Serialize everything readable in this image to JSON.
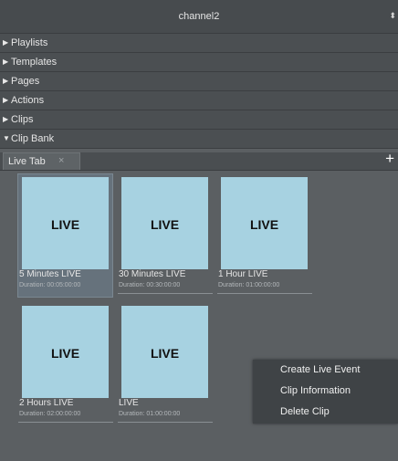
{
  "window": {
    "title": "channel2",
    "updown_icon": "updown-arrows-icon"
  },
  "sections": [
    {
      "label": "Playlists",
      "expanded": false
    },
    {
      "label": "Templates",
      "expanded": false
    },
    {
      "label": "Pages",
      "expanded": false
    },
    {
      "label": "Actions",
      "expanded": false
    },
    {
      "label": "Clips",
      "expanded": false
    },
    {
      "label": "Clip Bank",
      "expanded": true
    }
  ],
  "arrows": {
    "collapsed": "▶",
    "expanded": "▼"
  },
  "tabs": [
    {
      "label": "Live Tab",
      "close": "×"
    }
  ],
  "add_tab": "+",
  "clips": [
    {
      "thumb": "LIVE",
      "name": "5 Minutes LIVE",
      "duration": "Duration: 00:05:00:00",
      "selected": true
    },
    {
      "thumb": "LIVE",
      "name": "30 Minutes LIVE",
      "duration": "Duration: 00:30:00:00",
      "selected": false
    },
    {
      "thumb": "LIVE",
      "name": "1 Hour LIVE",
      "duration": "Duration: 01:00:00:00",
      "selected": false
    },
    {
      "thumb": "LIVE",
      "name": "2 Hours LIVE",
      "duration": "Duration: 02:00:00:00",
      "selected": false
    },
    {
      "thumb": "LIVE",
      "name": "LIVE",
      "duration": "Duration: 01:00:00:00",
      "selected": false
    }
  ],
  "context_menu": {
    "items": [
      "Create Live Event",
      "Clip Information",
      "Delete Clip"
    ]
  }
}
